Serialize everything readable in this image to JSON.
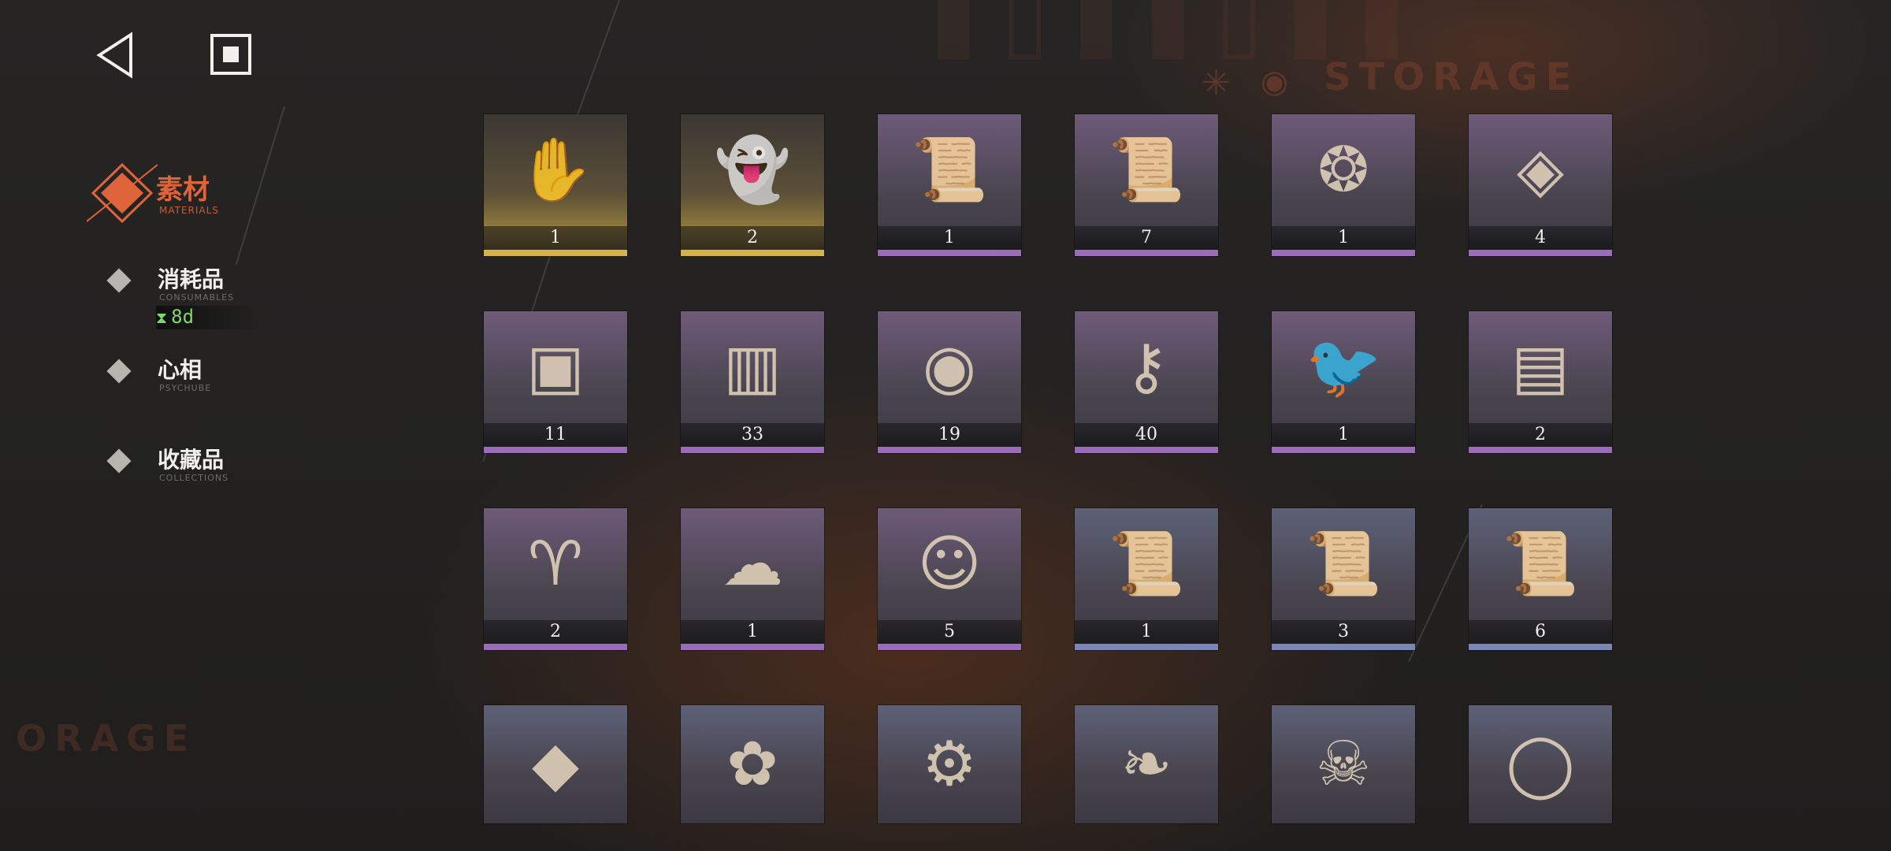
{
  "background": {
    "watermark_top": "STORAGE",
    "watermark_left": "ORAGE"
  },
  "nav": {
    "back_icon": "back-triangle-icon",
    "stop_icon": "stop-square-icon"
  },
  "categories": {
    "materials": {
      "label": "素材",
      "sub": "MATERIALS",
      "active": true
    },
    "consumables": {
      "label": "消耗品",
      "sub": "CONSUMABLES",
      "timer": "8d"
    },
    "psychube": {
      "label": "心相",
      "sub": "PSYCHUBE"
    },
    "collections": {
      "label": "收藏品",
      "sub": "COLLECTIONS"
    }
  },
  "colors": {
    "accent": "#e0643a",
    "gold": "#d7b14a",
    "purple": "#9a6cb8",
    "blue": "#7a86b6",
    "timer_green": "#7fd86a"
  },
  "items": [
    {
      "name": "relic-box-hand",
      "count": "1",
      "rarity": "gold"
    },
    {
      "name": "ghost-figure",
      "count": "2",
      "rarity": "gold"
    },
    {
      "name": "scrolls-red-seal",
      "count": "1",
      "rarity": "purple"
    },
    {
      "name": "scrolls-gold-seal",
      "count": "7",
      "rarity": "purple"
    },
    {
      "name": "scarab-pendant",
      "count": "1",
      "rarity": "purple"
    },
    {
      "name": "crystal-pendulum",
      "count": "4",
      "rarity": "purple"
    },
    {
      "name": "carved-stone-tablet",
      "count": "11",
      "rarity": "purple"
    },
    {
      "name": "wooden-frames",
      "count": "33",
      "rarity": "purple"
    },
    {
      "name": "brass-orb-device",
      "count": "19",
      "rarity": "purple"
    },
    {
      "name": "winged-key",
      "count": "40",
      "rarity": "purple"
    },
    {
      "name": "metal-bird",
      "count": "1",
      "rarity": "purple"
    },
    {
      "name": "silver-ingot-stack",
      "count": "2",
      "rarity": "purple"
    },
    {
      "name": "ram-skeleton",
      "count": "2",
      "rarity": "purple"
    },
    {
      "name": "wool-sprout",
      "count": "1",
      "rarity": "purple"
    },
    {
      "name": "doll-head",
      "count": "5",
      "rarity": "purple"
    },
    {
      "name": "scroll-red-seal",
      "count": "1",
      "rarity": "blue"
    },
    {
      "name": "scroll-green-seal",
      "count": "3",
      "rarity": "blue"
    },
    {
      "name": "scroll-gold-seal",
      "count": "6",
      "rarity": "blue"
    },
    {
      "name": "green-crystal",
      "count": "",
      "rarity": "blue"
    },
    {
      "name": "foxglove-flower",
      "count": "",
      "rarity": "blue"
    },
    {
      "name": "brass-gear",
      "count": "",
      "rarity": "blue"
    },
    {
      "name": "insect-wing",
      "count": "",
      "rarity": "blue"
    },
    {
      "name": "bone-pile",
      "count": "",
      "rarity": "blue"
    },
    {
      "name": "salt-plate",
      "count": "",
      "rarity": "blue"
    }
  ]
}
